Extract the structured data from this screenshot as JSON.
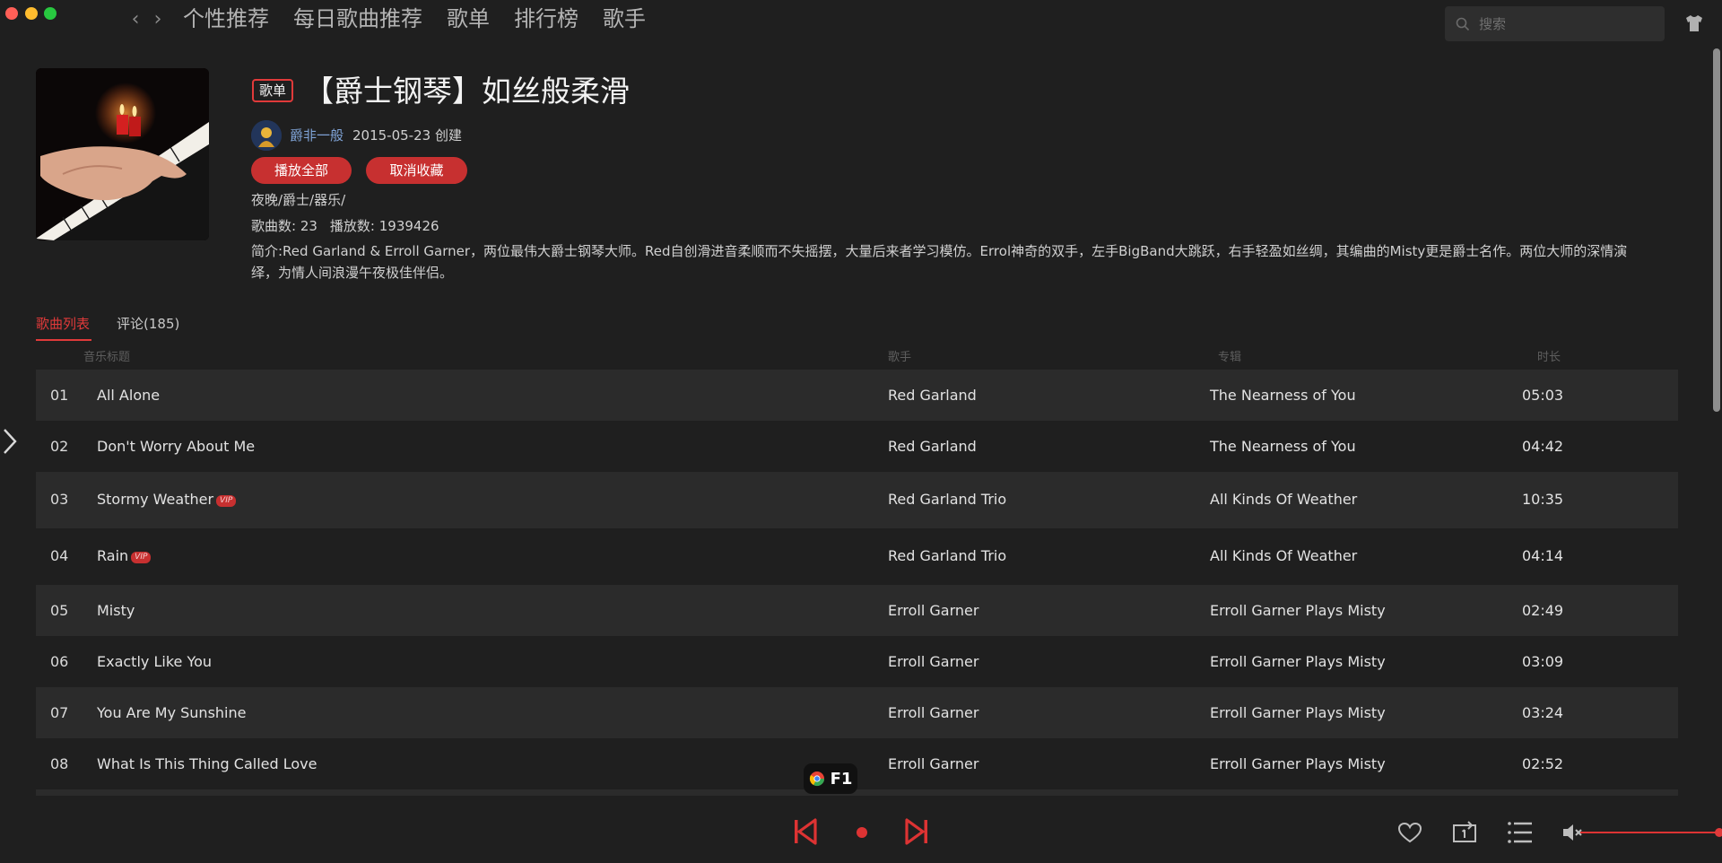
{
  "nav": {
    "tabs": [
      "个性推荐",
      "每日歌曲推荐",
      "歌单",
      "排行榜",
      "歌手"
    ],
    "search_placeholder": "搜索"
  },
  "playlist": {
    "type_label": "歌单",
    "title": "【爵士钢琴】如丝般柔滑",
    "creator": "爵非一般",
    "created": "2015-05-23 创建",
    "play_all_label": "播放全部",
    "unfavorite_label": "取消收藏",
    "tags": "夜晚/爵士/器乐/",
    "song_count": "歌曲数: 23",
    "play_count": "播放数: 1939426",
    "description": "简介:Red Garland & Erroll Garner，两位最伟大爵士钢琴大师。Red自创滑进音柔顺而不失摇摆，大量后来者学习模仿。Errol神奇的双手，左手BigBand大跳跃，右手轻盈如丝绸，其编曲的Misty更是爵士名作。两位大师的深情演绎，为情人间浪漫午夜极佳伴侣。"
  },
  "tabs": {
    "songs": "歌曲列表",
    "comments": "评论(185)"
  },
  "table": {
    "headers": {
      "title": "音乐标题",
      "artist": "歌手",
      "album": "专辑",
      "duration": "时长"
    },
    "vip_label": "VIP",
    "rows": [
      {
        "no": "01",
        "title": "All Alone",
        "vip": false,
        "artist": "Red Garland",
        "album": "The Nearness of You",
        "duration": "05:03"
      },
      {
        "no": "02",
        "title": "Don't Worry About Me",
        "vip": false,
        "artist": "Red Garland",
        "album": "The Nearness of You",
        "duration": "04:42"
      },
      {
        "no": "03",
        "title": "Stormy Weather",
        "vip": true,
        "artist": "Red Garland Trio",
        "album": "All Kinds Of Weather",
        "duration": "10:35"
      },
      {
        "no": "04",
        "title": "Rain",
        "vip": true,
        "artist": "Red Garland Trio",
        "album": "All Kinds Of Weather",
        "duration": "04:14"
      },
      {
        "no": "05",
        "title": "Misty",
        "vip": false,
        "artist": "Erroll Garner",
        "album": "Erroll Garner Plays Misty",
        "duration": "02:49"
      },
      {
        "no": "06",
        "title": "Exactly Like You",
        "vip": false,
        "artist": "Erroll Garner",
        "album": "Erroll Garner Plays Misty",
        "duration": "03:09"
      },
      {
        "no": "07",
        "title": "You Are My Sunshine",
        "vip": false,
        "artist": "Erroll Garner",
        "album": "Erroll Garner Plays Misty",
        "duration": "03:24"
      },
      {
        "no": "08",
        "title": "What Is This Thing Called Love",
        "vip": false,
        "artist": "Erroll Garner",
        "album": "Erroll Garner Plays Misty",
        "duration": "02:52"
      }
    ]
  },
  "overlay_badge": "F1",
  "player": {
    "volume": 1.0
  },
  "colors": {
    "accent": "#e03a3a",
    "background": "#1f1f1f",
    "row_stripe": "#2b2b2b"
  }
}
